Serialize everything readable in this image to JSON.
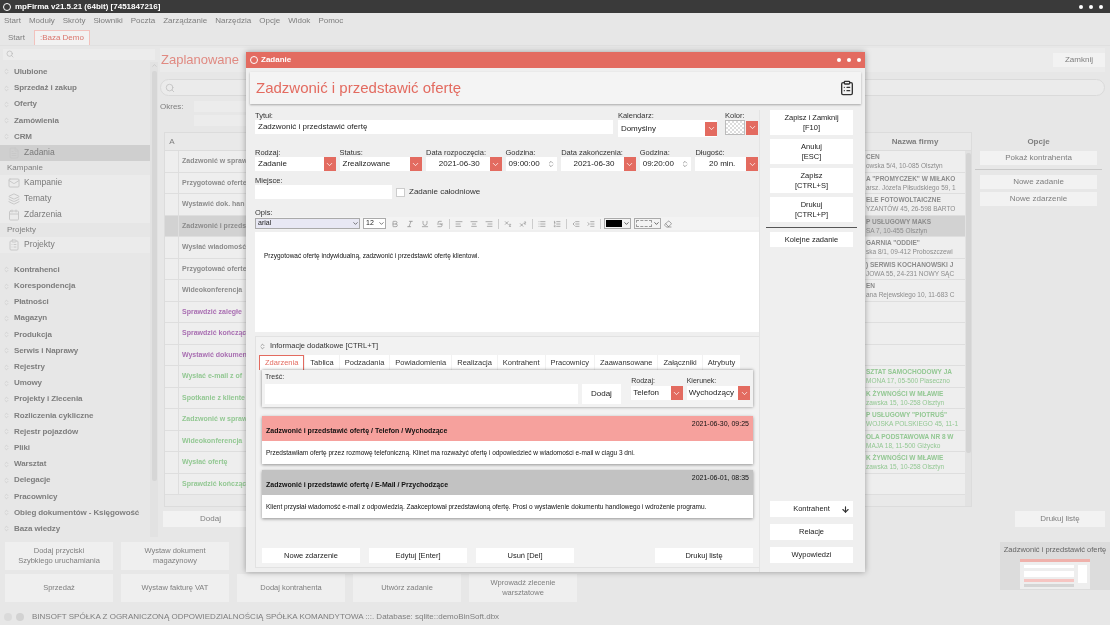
{
  "app": {
    "title": "mpFirma v21.5.21 (64bit) [7451847216]"
  },
  "menu": [
    "Start",
    "Moduły",
    "Skróty",
    "Słowniki",
    "Poczta",
    "Zarządzanie",
    "Narzędzia",
    "Opcje",
    "Widok",
    "Pomoc"
  ],
  "tabs": [
    {
      "label": "Start",
      "selected": false
    },
    {
      "label": ":Baza Demo",
      "selected": true
    }
  ],
  "sidebar": {
    "sections": [
      {
        "label": "Ulubione"
      },
      {
        "label": "Sprzedaż i zakup"
      },
      {
        "label": "Oferty"
      },
      {
        "label": "Zamówienia"
      },
      {
        "label": "CRM",
        "children": [
          {
            "kind": "item",
            "label": "Zadania",
            "selected": true
          },
          {
            "kind": "group",
            "label": "Kampanie",
            "children": [
              {
                "kind": "item",
                "label": "Kampanie",
                "selected": false
              },
              {
                "kind": "item",
                "label": "Tematy",
                "selected": false
              },
              {
                "kind": "item",
                "label": "Zdarzenia",
                "selected": false
              }
            ]
          },
          {
            "kind": "group",
            "label": "Projekty",
            "children": [
              {
                "kind": "item",
                "label": "Projekty",
                "selected": false
              }
            ]
          }
        ]
      },
      {
        "label": "Kontrahenci"
      },
      {
        "label": "Korespondencja"
      },
      {
        "label": "Płatności"
      },
      {
        "label": "Magazyn"
      },
      {
        "label": "Produkcja"
      },
      {
        "label": "Serwis i Naprawy"
      },
      {
        "label": "Rejestry"
      },
      {
        "label": "Umowy"
      },
      {
        "label": "Projekty i Zlecenia"
      },
      {
        "label": "Rozliczenia cykliczne"
      },
      {
        "label": "Rejestr pojazdów"
      },
      {
        "label": "Pliki"
      },
      {
        "label": "Warsztat"
      },
      {
        "label": "Delegacje"
      },
      {
        "label": "Pracownicy"
      },
      {
        "label": "Obieg dokumentów - Księgowość"
      },
      {
        "label": "Baza wiedzy"
      }
    ]
  },
  "list_view": {
    "title": "Zaplanowane",
    "close_button": "Zamknij",
    "period_label": "Okres:",
    "table": {
      "columns": [
        "A",
        "Nazwa firmy"
      ],
      "rows": [
        {
          "title": "Zadzwonić w spraw",
          "company": "CEN",
          "address": "owska 5/4, 10-085 Olsztyn",
          "color": "#8c8c8c",
          "selected": false
        },
        {
          "title": "Przygotować oferte",
          "company": "A \"PROMYCZEK\" W MIŁAKO",
          "address": "arsz. Józefa Piłsudskiego 59, 1",
          "color": "#8c8c8c",
          "selected": false
        },
        {
          "title": "Wystawić dok. han",
          "company": "ELE FOTOWOLTAICZNE",
          "address": "YZANTÓW 45, 26-598 BARTO",
          "color": "#8c8c8c",
          "selected": false
        },
        {
          "title": "Zadzwonić i przeds",
          "company": "P USŁUGOWY MAKS",
          "address": "SA 7, 10-455 Olsztyn",
          "color": "#8c8c8c",
          "selected": true
        },
        {
          "title": "Wysłać wiadomość",
          "company": "GARNIA \"ODDIE\"",
          "address": "ska 8/1, 09-412 Proboszczewi",
          "color": "#8c8c8c",
          "selected": false
        },
        {
          "title": "Przygotować oferte",
          "company": ") SERWIS KOCHANOWSKI J",
          "address": "JOWA 55, 24-231 NOWY SĄC",
          "color": "#8c8c8c",
          "selected": false
        },
        {
          "title": "Wideokonferencja",
          "company": "EN",
          "address": "ana Rejewskiego 10, 11-683 C",
          "color": "#8c8c8c",
          "selected": false
        },
        {
          "title": "Sprawdzić zaległe",
          "color": "#a96fb2",
          "selected": false
        },
        {
          "title": "Sprawdzić kończąc",
          "color": "#a96fb2",
          "selected": false
        },
        {
          "title": "Wystawić dokumen",
          "color": "#a96fb2",
          "selected": false
        },
        {
          "title": "Wysłać e-mail z of",
          "company": "SZTAT SAMOCHODOWY JA",
          "address": "MONA 17, 05-500 Piaseczno",
          "color": "#93c893",
          "selected": false
        },
        {
          "title": "Spotkanie z kliente",
          "company": "K ŻYWNOŚCI W MŁAWIE",
          "address": "zawska 15, 10-258 Olsztyn",
          "color": "#93c893",
          "selected": false
        },
        {
          "title": "Zadzwonić w spraw",
          "company": "P USŁUGOWY \"PIOTRUŚ\"",
          "address": "WOJSKA POLSKIEGO 45, 11-1",
          "color": "#93c893",
          "selected": false
        },
        {
          "title": "Wideokonferencja",
          "company": "OLA PODSTAWOWA NR 8 W",
          "address": "MAJA 18, 11-500 Giżycko",
          "color": "#93c893",
          "selected": false
        },
        {
          "title": "Wysłać ofertę",
          "company": "K ŻYWNOŚCI W MŁAWIE",
          "address": "zawska 15, 10-258 Olsztyn",
          "color": "#93c893",
          "selected": false
        },
        {
          "title": "Sprawdzić kończąc",
          "color": "#93c893",
          "selected": false
        }
      ]
    },
    "options": {
      "title": "Opcje",
      "buttons": [
        "Pokaż kontrahenta",
        "Nowe zadanie",
        "Nowe zdarzenie"
      ]
    },
    "add_button": "Dodaj",
    "print_button": "Drukuj listę"
  },
  "quick_buttons": [
    [
      "Dodaj przyciski\nSzybkiego uruchamiania",
      "Wystaw dokument\nmagazynowy"
    ],
    [
      "Sprzedaż",
      "Wystaw fakturę VAT",
      "Dodaj kontrahenta",
      "Utwórz zadanie",
      "Wprowadź zlecenie\nwarsztatowe"
    ]
  ],
  "preview": {
    "title": "Zadzwonić i przedstawić ofertę"
  },
  "status_bar": "BINSOFT SPÓŁKA Z OGRANICZONĄ ODPOWIEDZIALNOŚCIĄ SPÓŁKA KOMANDYTOWA :::. Database: sqlite::demoBinSoft.dbx",
  "dialog": {
    "title": "Zadanie",
    "heading": "Zadzwonić i przedstawić ofertę",
    "title_field": {
      "label": "Tytuł:",
      "value": "Zadzwonić i przedstawić ofertę"
    },
    "calendar": {
      "label": "Kalendarz:",
      "value": "Domyślny"
    },
    "color_field": {
      "label": "Kolor:"
    },
    "fields": [
      {
        "kind": "select",
        "label": "Rodzaj:",
        "value": "Zadanie"
      },
      {
        "kind": "select",
        "label": "Status:",
        "value": "Zrealizowane"
      },
      {
        "kind": "date",
        "label": "Data rozpoczęcia:",
        "value": "2021-06-30"
      },
      {
        "kind": "spin",
        "label": "Godzina:",
        "value": "09:00:00"
      },
      {
        "kind": "date",
        "label": "Data zakończenia:",
        "value": "2021-06-30"
      },
      {
        "kind": "spin",
        "label": "Godzina:",
        "value": "09:20:00"
      },
      {
        "kind": "date",
        "label": "Długość:",
        "value": "20 min."
      }
    ],
    "place": {
      "label": "Miejsce:"
    },
    "all_day": {
      "label": "Zadanie całodniowe",
      "checked": false
    },
    "description": {
      "label": "Opis:",
      "font": "arial",
      "size": "12",
      "text": "Przygotować ofertę indywidualną, zadzwonić i przedstawić ofertę klientowi."
    },
    "extra": {
      "label": "Informacje dodatkowe [CTRL+T]",
      "tabs": [
        {
          "label": "Zdarzenia",
          "selected": true
        },
        {
          "label": "Tablica",
          "selected": false
        },
        {
          "label": "Podzadania",
          "selected": false
        },
        {
          "label": "Powiadomienia",
          "selected": false
        },
        {
          "label": "Realizacja",
          "selected": false
        },
        {
          "label": "Kontrahent",
          "selected": false
        },
        {
          "label": "Pracownicy",
          "selected": false
        },
        {
          "label": "Zaawansowane",
          "selected": false
        },
        {
          "label": "Załączniki",
          "selected": false
        },
        {
          "label": "Atrybuty",
          "selected": false
        }
      ],
      "content_label": "Treść:",
      "add_button": "Dodaj",
      "type": {
        "label": "Rodzaj:",
        "value": "Telefon"
      },
      "direction": {
        "label": "Kierunek:",
        "value": "Wychodzący"
      },
      "events": [
        {
          "title": "Zadzwonić i przedstawić ofertę / Telefon / Wychodzące",
          "date": "2021-06-30, 09:25",
          "text": "Przedstawiłam ofertę przez rozmowę telefoniczną. Klinet ma rozważyć ofertę i odpowiedzieć w wiadomości e-mail w ciągu 3 dni.",
          "color": "#f6a19d"
        },
        {
          "title": "Zadzwonić i przedstawić ofertę / E-Mail / Przychodzące",
          "date": "2021-06-01, 08:35",
          "text": "Klient przysłał wiadomość e-mail z odpowiedzią. Zaakceptował przedstawioną ofertę. Prosi o wystawienie dokumentu handlowego i wdrożenie programu.",
          "color": "#c2c2c2"
        }
      ],
      "buttons": [
        "Nowe zdarzenie",
        "Edytuj [Enter]",
        "Usuń [Del]",
        "Drukuj listę"
      ]
    },
    "actions": [
      {
        "label": "Zapisz i Zamknij",
        "shortcut": "[F10]"
      },
      {
        "label": "Anuluj",
        "shortcut": "[ESC]"
      },
      {
        "label": "Zapisz",
        "shortcut": "[CTRL+S]"
      },
      {
        "label": "Drukuj",
        "shortcut": "[CTRL+P]"
      }
    ],
    "next_button": "Kolejne zadanie",
    "side_buttons": [
      {
        "kind": "arrow",
        "label": "Kontrahent"
      },
      {
        "kind": "plain",
        "label": "Relacje"
      },
      {
        "kind": "plain",
        "label": "Wypowiedzi"
      }
    ]
  }
}
